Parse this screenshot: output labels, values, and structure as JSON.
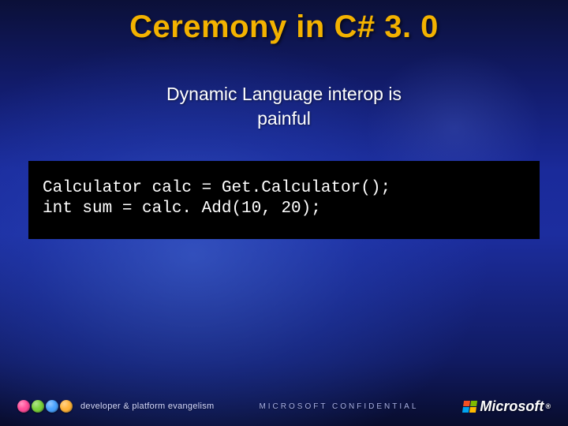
{
  "title": "Ceremony in C# 3. 0",
  "subtitle_line1": "Dynamic Language interop is",
  "subtitle_line2": "painful",
  "code": "Calculator calc = Get.Calculator();\nint sum = calc. Add(10, 20);",
  "footer": {
    "brand_sub": "developer & platform evangelism",
    "confidential": "MICROSOFT CONFIDENTIAL",
    "logo_text": "Microsoft"
  }
}
